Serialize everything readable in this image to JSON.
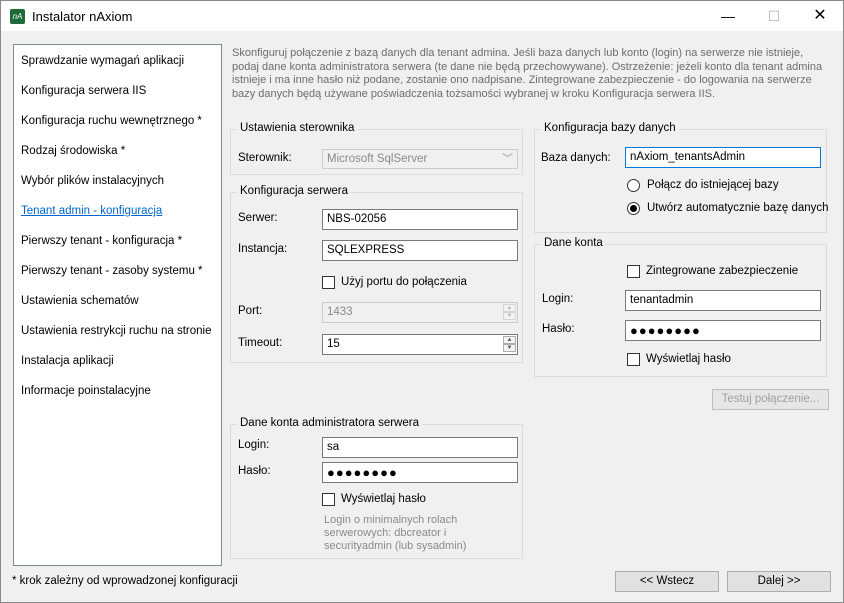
{
  "window": {
    "title": "Instalator nAxiom",
    "icon_label": "nA",
    "min_glyph": "—",
    "max_glyph": "☐",
    "close_glyph": "✕"
  },
  "steps": [
    {
      "label": "Sprawdzanie wymagań aplikacji"
    },
    {
      "label": "Konfiguracja serwera IIS"
    },
    {
      "label": "Konfiguracja ruchu wewnętrznego *"
    },
    {
      "label": "Rodzaj środowiska *"
    },
    {
      "label": "Wybór plików instalacyjnych"
    },
    {
      "label": "Tenant admin - konfiguracja",
      "active": true
    },
    {
      "label": "Pierwszy tenant - konfiguracja *"
    },
    {
      "label": "Pierwszy tenant - zasoby systemu *"
    },
    {
      "label": "Ustawienia schematów"
    },
    {
      "label": "Ustawienia restrykcji ruchu na stronie"
    },
    {
      "label": "Instalacja aplikacji"
    },
    {
      "label": "Informacje poinstalacyjne"
    }
  ],
  "footnote": "* krok zależny od wprowadzonej konfiguracji",
  "description": "Skonfiguruj połączenie z bazą danych dla tenant admina. Jeśli baza danych lub konto (login) na serwerze nie istnieje, podaj dane konta administratora serwera (te dane nie będą przechowywane). Ostrzeżenie: jeżeli konto dla tenant admina istnieje i ma inne hasło niż podane, zostanie ono nadpisane.  Zintegrowane zabezpieczenie - do logowania na serwerze bazy danych będą używane poświadczenia tożsamości wybranej w kroku Konfiguracja serwera IIS.",
  "driver_group": {
    "title": "Ustawienia sterownika",
    "driver_label": "Sterownik:",
    "driver_value": "Microsoft SqlServer",
    "arrow_glyph": "﹀"
  },
  "server_group": {
    "title": "Konfiguracja serwera",
    "server_label": "Serwer:",
    "server_value": "NBS-02056",
    "instance_label": "Instancja:",
    "instance_value": "SQLEXPRESS",
    "use_port_label": "Użyj portu do połączenia",
    "port_label": "Port:",
    "port_value": "1433",
    "timeout_label": "Timeout:",
    "timeout_value": "15",
    "spin_up": "▲",
    "spin_down": "▼"
  },
  "admin_group": {
    "title": "Dane konta administratora serwera",
    "login_label": "Login:",
    "login_value": "sa",
    "password_label": "Hasło:",
    "password_value": "●●●●●●●●",
    "show_password_label": "Wyświetlaj hasło",
    "hint": "Login o minimalnych rolach serwerowych: dbcreator i securityadmin (lub sysadmin)"
  },
  "db_group": {
    "title": "Konfiguracja bazy danych",
    "db_label": "Baza danych:",
    "db_value": "nAxiom_tenantsAdmin",
    "connect_existing_label": "Połącz do istniejącej bazy",
    "create_auto_label": "Utwórz automatycznie bazę danych"
  },
  "account_group": {
    "title": "Dane konta",
    "integrated_label": "Zintegrowane zabezpieczenie",
    "login_label": "Login:",
    "login_value": "tenantadmin",
    "password_label": "Hasło:",
    "password_value": "●●●●●●●●",
    "show_password_label": "Wyświetlaj hasło"
  },
  "buttons": {
    "test_connection": "Testuj połączenie...",
    "back": "<< Wstecz",
    "next": "Dalej >>"
  }
}
